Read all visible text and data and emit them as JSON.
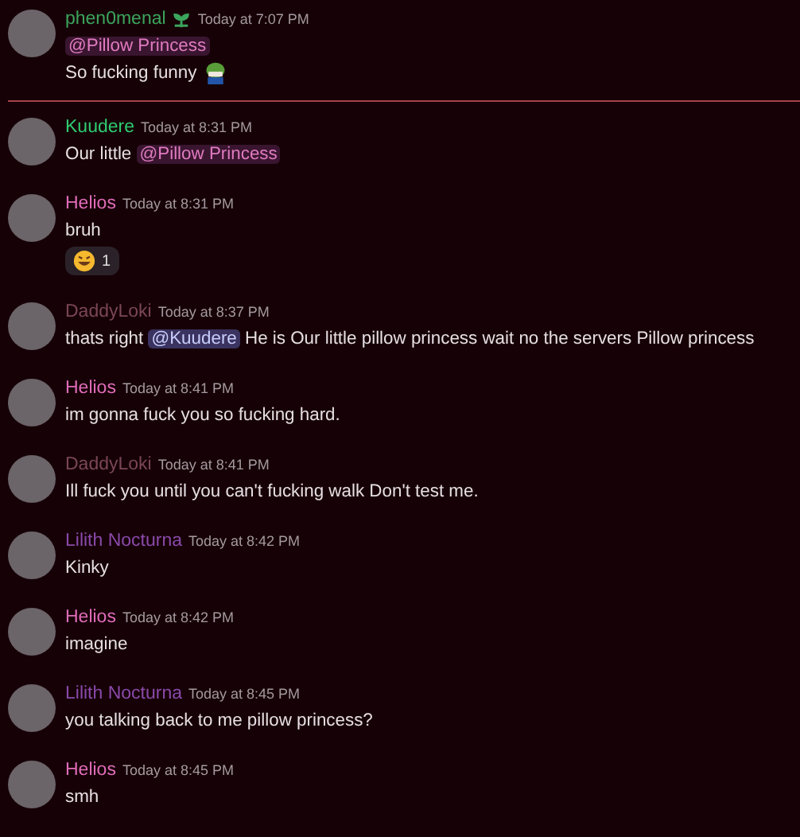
{
  "items": [
    {
      "kind": "message",
      "author": "phen0menal",
      "color": "#3ba55c",
      "badges": [
        {
          "kind": "leaf"
        }
      ],
      "time": "Today at 7:07 PM",
      "lines": [
        [
          {
            "kind": "role_mention",
            "text": "@Pillow Princess"
          }
        ],
        [
          {
            "kind": "text",
            "text": "So fucking funny"
          },
          {
            "kind": "emoji"
          }
        ]
      ]
    },
    {
      "kind": "divider"
    },
    {
      "kind": "message",
      "author": "Kuudere",
      "color": "#2ecc71",
      "time": "Today at 8:31 PM",
      "lines": [
        [
          {
            "kind": "text",
            "text": "Our little "
          },
          {
            "kind": "role_mention",
            "text": "@Pillow Princess"
          }
        ]
      ]
    },
    {
      "kind": "message",
      "author": "Helios",
      "color": "#e06cb8",
      "time": "Today at 8:31 PM",
      "lines": [
        [
          {
            "kind": "text",
            "text": "bruh"
          }
        ]
      ],
      "reactions": [
        {
          "count": "1"
        }
      ]
    },
    {
      "kind": "message",
      "author": "DaddyLoki",
      "color": "#7a4658",
      "time": "Today at 8:37 PM",
      "lines": [
        [
          {
            "kind": "text",
            "text": "thats right "
          },
          {
            "kind": "user_mention",
            "text": "@Kuudere"
          },
          {
            "kind": "text",
            "text": " He is Our little pillow princess wait no the servers Pillow princess"
          }
        ]
      ]
    },
    {
      "kind": "message",
      "author": "Helios",
      "color": "#e06cb8",
      "time": "Today at 8:41 PM",
      "lines": [
        [
          {
            "kind": "text",
            "text": "im gonna fuck you so fucking hard."
          }
        ]
      ]
    },
    {
      "kind": "message",
      "author": "DaddyLoki",
      "color": "#7a4658",
      "time": "Today at 8:41 PM",
      "lines": [
        [
          {
            "kind": "text",
            "text": "Ill fuck you until you can't fucking walk Don't test me."
          }
        ]
      ]
    },
    {
      "kind": "message",
      "author": "Lilith Nocturna",
      "color": "#8a4aaa",
      "time": "Today at 8:42 PM",
      "lines": [
        [
          {
            "kind": "text",
            "text": "Kinky"
          }
        ]
      ]
    },
    {
      "kind": "message",
      "author": "Helios",
      "color": "#e06cb8",
      "time": "Today at 8:42 PM",
      "lines": [
        [
          {
            "kind": "text",
            "text": "imagine"
          }
        ]
      ]
    },
    {
      "kind": "message",
      "author": "Lilith Nocturna",
      "color": "#8a4aaa",
      "time": "Today at 8:45 PM",
      "lines": [
        [
          {
            "kind": "text",
            "text": "you talking back to me pillow princess?"
          }
        ]
      ]
    },
    {
      "kind": "message",
      "author": "Helios",
      "color": "#e06cb8",
      "time": "Today at 8:45 PM",
      "lines": [
        [
          {
            "kind": "text",
            "text": "smh"
          }
        ]
      ]
    }
  ]
}
